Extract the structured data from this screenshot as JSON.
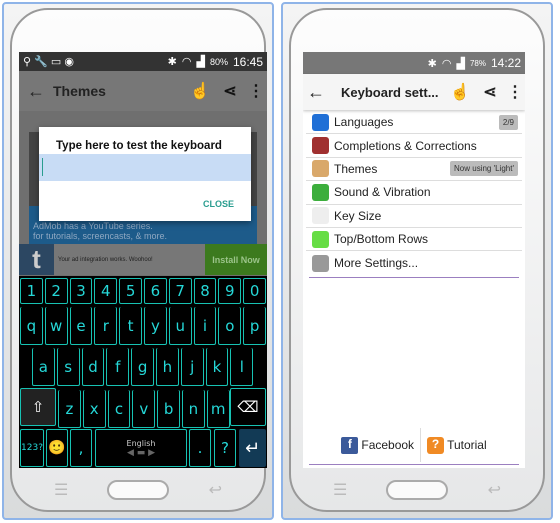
{
  "left": {
    "status": {
      "icons": [
        "usb-icon",
        "wrench-icon",
        "voicemail-icon",
        "shield-icon",
        "bluetooth-icon",
        "wifi-icon",
        "signal-icon"
      ],
      "battery": "80%",
      "time": "16:45"
    },
    "appbar": {
      "title": "Themes",
      "icons": [
        "keyboard-hand-icon",
        "share-icon",
        "more-vert-icon"
      ]
    },
    "dialog": {
      "title": "Type here to test the keyboard",
      "input_value": "",
      "close_label": "CLOSE"
    },
    "background_text": {
      "line1": "AdMob has a YouTube series.",
      "line2": "for tutorials, screencasts, & more."
    },
    "ad": {
      "text": "Your ad integration works. Woohoo!",
      "button": "Install Now"
    },
    "keyboard": {
      "row_numbers": [
        "1",
        "2",
        "3",
        "4",
        "5",
        "6",
        "7",
        "8",
        "9",
        "0"
      ],
      "row1": [
        "q",
        "w",
        "e",
        "r",
        "t",
        "y",
        "u",
        "i",
        "o",
        "p"
      ],
      "row2": [
        "a",
        "s",
        "d",
        "f",
        "g",
        "h",
        "j",
        "k",
        "l"
      ],
      "row3": [
        "z",
        "x",
        "c",
        "v",
        "b",
        "n",
        "m"
      ],
      "symbols_key": "123?",
      "emoji": "🙂",
      "comma": ",",
      "space_label": "English",
      "period": ".",
      "question": "?",
      "accent": "#17c2b3",
      "text_color": "#25d8d8"
    }
  },
  "right": {
    "status": {
      "battery": "78%",
      "time": "14:22"
    },
    "appbar": {
      "title": "Keyboard sett...",
      "icons": [
        "keyboard-hand-icon",
        "share-icon",
        "more-vert-icon"
      ]
    },
    "items": [
      {
        "label": "Languages",
        "badge": "2/9",
        "icon": "globe-icon",
        "color": "#1f6fd6"
      },
      {
        "label": "Completions & Corrections",
        "icon": "dictionary-icon",
        "color": "#a03030"
      },
      {
        "label": "Themes",
        "badge": "Now using 'Light'",
        "icon": "palette-icon",
        "color": "#d9a86a"
      },
      {
        "label": "Sound & Vibration",
        "icon": "music-note-icon",
        "color": "#3cae3c"
      },
      {
        "label": "Key Size",
        "icon": "key-size-icon",
        "color": "#eeeeee"
      },
      {
        "label": "Top/Bottom Rows",
        "icon": "keyboard-rows-icon",
        "color": "#66dd44"
      },
      {
        "label": "More Settings...",
        "icon": "gears-icon",
        "color": "#999999"
      }
    ],
    "footer": {
      "facebook": "Facebook",
      "tutorial": "Tutorial"
    },
    "accent": "#9b7fc0"
  }
}
